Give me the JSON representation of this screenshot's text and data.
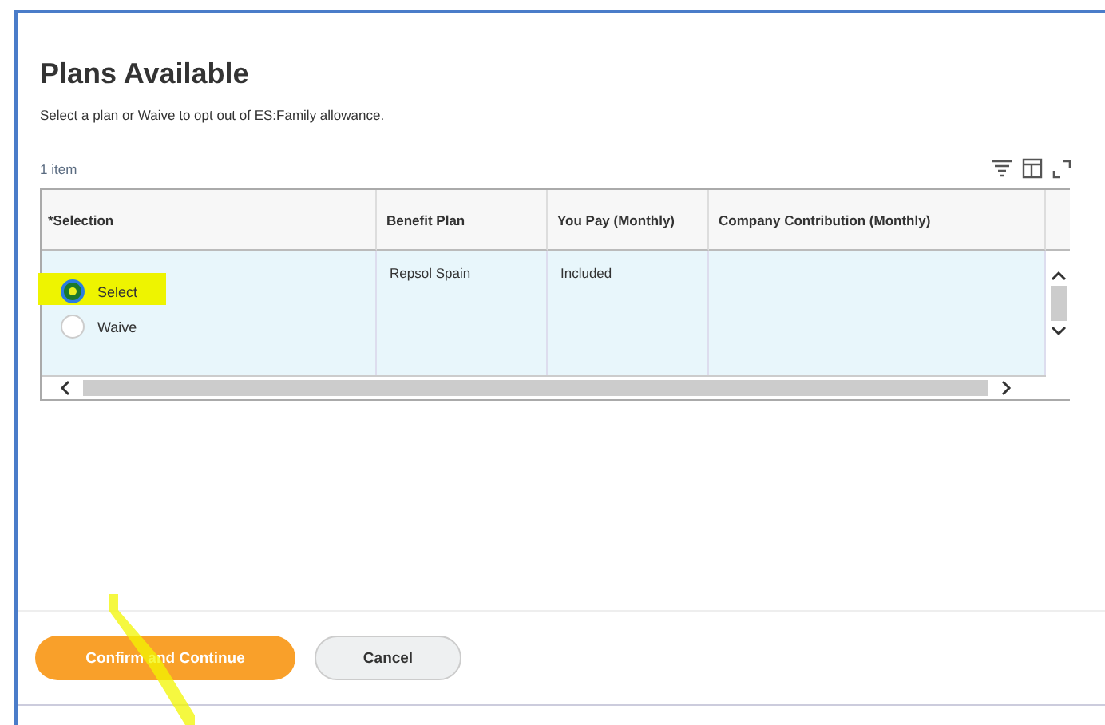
{
  "title": "Plans Available",
  "subtitle": "Select a plan or Waive to opt out of ES:Family allowance.",
  "item_count": "1 item",
  "table": {
    "columns": [
      "*Selection",
      "Benefit Plan",
      "You Pay (Monthly)",
      "Company Contribution (Monthly)"
    ],
    "rows": [
      {
        "options": [
          {
            "label": "Select",
            "selected": true
          },
          {
            "label": "Waive",
            "selected": false
          }
        ],
        "benefit_plan": "Repsol Spain",
        "you_pay": "Included",
        "company_contribution": ""
      }
    ]
  },
  "buttons": [
    {
      "label": "Confirm and Continue",
      "kind": "primary"
    },
    {
      "label": "Cancel",
      "kind": "secondary"
    }
  ]
}
